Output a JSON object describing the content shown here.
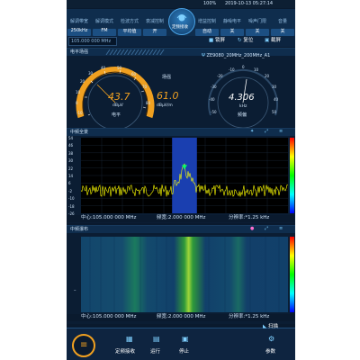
{
  "status": {
    "battery": "100%",
    "datetime": "2019-10-13 05:27:14"
  },
  "tabs": [
    {
      "label": "解调带宽",
      "value": "250kHz"
    },
    {
      "label": "解调模式",
      "value": "FM"
    },
    {
      "label": "检波方式",
      "value": "平均值"
    },
    {
      "label": "衰减控制",
      "value": "开"
    },
    {
      "label": "增益控制",
      "value": "自动"
    },
    {
      "label": "静噪电平",
      "value": "关"
    },
    {
      "label": "噪声门限",
      "value": "关"
    },
    {
      "label": "音量",
      "value": "关"
    }
  ],
  "center_button_label": "定频接收",
  "frequency_input": "105.000 000 MHz",
  "toolbar": {
    "lock": "锁屏",
    "reset": "复位",
    "screenshot": "截屏"
  },
  "meter_section": {
    "title": "电平场强",
    "antenna": "ZE9080_20MHz_200MHz_A1",
    "level": {
      "value": "43.7",
      "unit": "dBμV",
      "name": "电平",
      "scale": [
        "-10",
        "0",
        "10",
        "20",
        "30",
        "40",
        "50",
        "60",
        "70",
        "80"
      ]
    },
    "field_strength": {
      "value": "61.0",
      "unit": "dBμV/m",
      "name": "场强"
    },
    "offset": {
      "value": "4.306",
      "unit": "kHz",
      "name": "频偏",
      "scale": [
        "-50",
        "-40",
        "-30",
        "-20",
        "-10",
        "0",
        "10",
        "20",
        "30",
        "40",
        "50"
      ]
    }
  },
  "spectrum_section": {
    "title": "中频全景",
    "y_ticks": [
      "54",
      "46",
      "38",
      "30",
      "22",
      "14",
      "6",
      "-2",
      "-10",
      "-18",
      "-26"
    ],
    "info": {
      "center": "中心:105.000 000 MHz",
      "span": "频宽:2.000 000 MHz",
      "resolution": "分辨率:*1.25 kHz"
    }
  },
  "waterfall_section": {
    "title": "中频瀑布",
    "info": {
      "center": "中心:105.000 000 MHz",
      "span": "频宽:2.000 000 MHz",
      "resolution": "分辨率:*1.25 kHz"
    },
    "scan_label": "扫描"
  },
  "bottom": {
    "fixed_freq": "定频接收",
    "run": "运行",
    "stop": "停止",
    "params": "参数"
  },
  "colors": {
    "accent": "#f0a020",
    "trace": "#ffff00",
    "band": "#1a3fb0",
    "bg": "#0a1a2e"
  }
}
